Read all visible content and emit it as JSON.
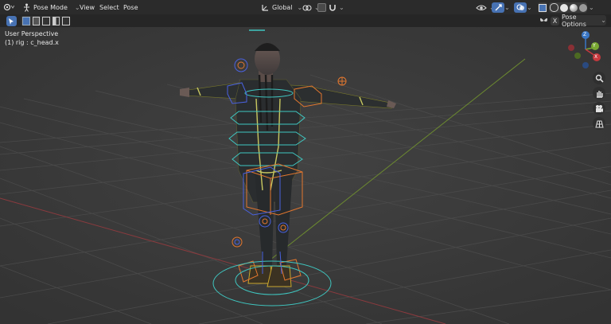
{
  "header": {
    "mode_label": "Pose Mode",
    "menus": [
      "View",
      "Select",
      "Pose"
    ],
    "orientation_label": "Global"
  },
  "tool_header": {
    "x_label": "X",
    "pose_options_label": "Pose Options"
  },
  "viewport": {
    "perspective_label": "User Perspective",
    "active_label": "(1) rig : c_head.x"
  },
  "gizmo": {
    "x_axis": "X",
    "y_axis": "Y",
    "z_axis": "Z"
  },
  "colors": {
    "x_axis": "#c6393e",
    "y_axis": "#79a832",
    "z_axis": "#3a77c6",
    "bone_cyan": "#3fc6c0",
    "bone_orange": "#e3772e",
    "bone_blue": "#4a62e0"
  },
  "icons": [
    "editor-type-icon",
    "pose-mode-icon",
    "orientation-icon",
    "pivot-icon",
    "snap-icon",
    "overlay-icon",
    "gizmo-icon",
    "shading-solid-icon",
    "zoom-icon",
    "pan-icon",
    "camera-icon",
    "grid-icon"
  ]
}
